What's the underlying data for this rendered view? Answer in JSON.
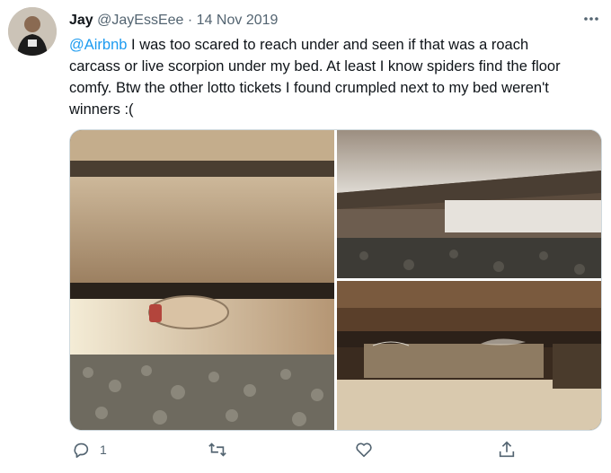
{
  "tweet": {
    "display_name": "Jay",
    "handle": "@JayEssEee",
    "separator": "·",
    "date": "14 Nov 2019",
    "mention": "@Airbnb",
    "text": " I was too scared to reach under and seen if that was a roach carcass or live scorpion under my bed. At least I know spiders find the floor comfy. Btw the other lotto tickets I found crumpled next to my bed weren't winners :("
  },
  "actions": {
    "reply_count": "1"
  },
  "colors": {
    "link": "#1d9bf0",
    "muted": "#536471"
  }
}
